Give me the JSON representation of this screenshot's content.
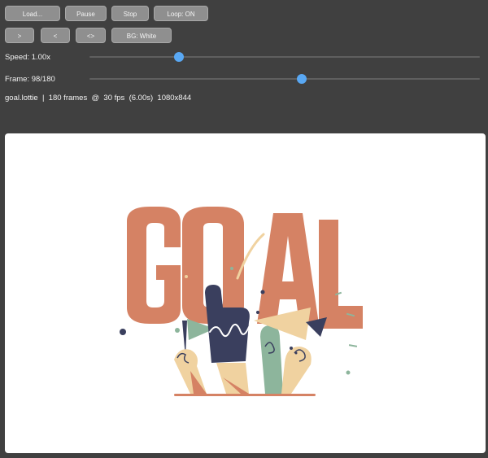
{
  "toolbar": {
    "load_label": "Load...",
    "pause_label": "Pause",
    "stop_label": "Stop",
    "loop_label": "Loop: ON",
    "next_label": ">",
    "prev_label": "<",
    "bounce_label": "<>",
    "bg_label": "BG: White"
  },
  "speed": {
    "label": "Speed: 1.00x",
    "value": 1.0,
    "position_fraction": 0.23
  },
  "frame": {
    "label": "Frame: 98/180",
    "current": 98,
    "total": 180,
    "position_fraction": 0.544
  },
  "info": {
    "text": "goal.lottie  |  180 frames  @  30 fps  (6.00s)  1080x844"
  },
  "animation": {
    "word": "GOAL",
    "colors": {
      "letters": "#d58264",
      "navy": "#3a3f5e",
      "sage": "#8db59c",
      "cream": "#f0d2a0",
      "ground": "#d58264"
    }
  }
}
